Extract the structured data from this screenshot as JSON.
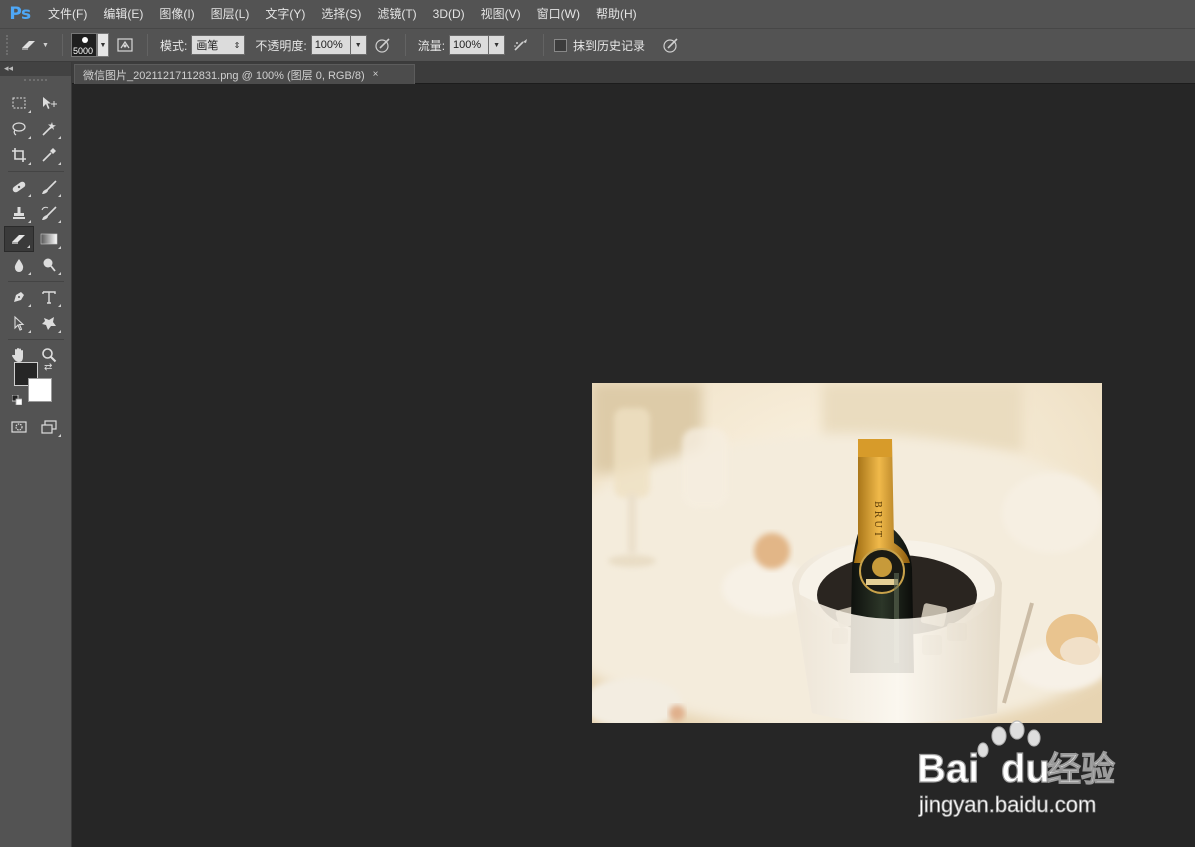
{
  "app": {
    "logo": "Ps"
  },
  "menu": [
    "文件(F)",
    "编辑(E)",
    "图像(I)",
    "图层(L)",
    "文字(Y)",
    "选择(S)",
    "滤镜(T)",
    "3D(D)",
    "视图(V)",
    "窗口(W)",
    "帮助(H)"
  ],
  "options": {
    "brush_size": "5000",
    "mode_label": "模式:",
    "mode_value": "画笔",
    "opacity_label": "不透明度:",
    "opacity_value": "100%",
    "flow_label": "流量:",
    "flow_value": "100%",
    "erase_history_label": "抹到历史记录",
    "erase_history_checked": false
  },
  "toolbox": {
    "collapse_glyph": "◂◂"
  },
  "document": {
    "tab_title": "微信图片_20211217112831.png @ 100% (图层 0, RGB/8)",
    "tab_close": "×"
  },
  "colors": {
    "foreground": "#262626",
    "background": "#ffffff"
  },
  "image_content": {
    "label_text": "BRUT"
  },
  "watermark": {
    "brand_bai": "Bai",
    "brand_du": "du",
    "brand_cn": "经验",
    "url": "jingyan.baidu.com"
  }
}
